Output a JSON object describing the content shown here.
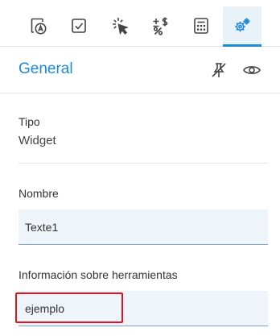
{
  "tabs": [
    {
      "name": "tab-label-settings",
      "icon": "document-letter-icon"
    },
    {
      "name": "tab-validation",
      "icon": "checkbox-icon"
    },
    {
      "name": "tab-actions",
      "icon": "click-cursor-icon"
    },
    {
      "name": "tab-number-format",
      "icon": "plus-minus-dollar-percent-icon"
    },
    {
      "name": "tab-calculation",
      "icon": "calculator-icon"
    },
    {
      "name": "tab-general-settings",
      "icon": "gears-icon",
      "active": true
    }
  ],
  "header": {
    "title": "General",
    "icons": [
      "pin-off-icon",
      "eye-icon"
    ]
  },
  "fields": {
    "type_label": "Tipo",
    "type_value": "Widget",
    "name_label": "Nombre",
    "name_value": "Texte1",
    "tooltip_label": "Información sobre herramientas",
    "tooltip_value": "ejemplo"
  },
  "colors": {
    "accent": "#1f8ad6",
    "active_tab_bg": "#e9f2f9",
    "input_bg": "#eef4fa",
    "highlight": "#e3121e"
  }
}
